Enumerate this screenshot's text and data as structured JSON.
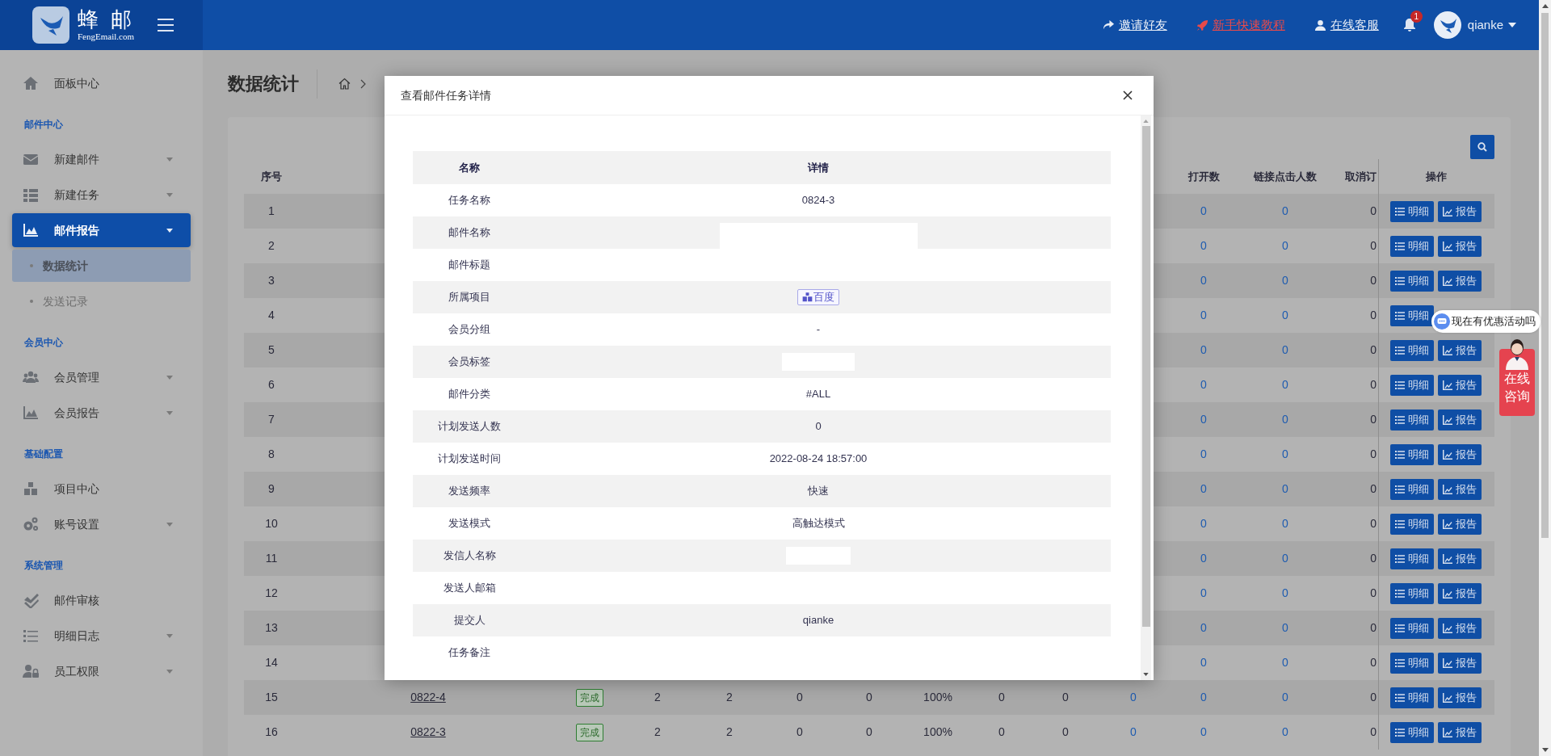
{
  "header": {
    "logo_text": "蜂 邮",
    "logo_subtext": "FengEmail.com",
    "links": [
      {
        "label": "邀请好友",
        "kind": "normal"
      },
      {
        "label": "新手快速教程",
        "kind": "highlight"
      },
      {
        "label": "在线客服",
        "kind": "normal"
      }
    ],
    "notifications": "1",
    "user": "qianke"
  },
  "sidebar": [
    {
      "kind": "item",
      "label": "面板中心",
      "expandable": false,
      "selected": false
    },
    {
      "kind": "section",
      "label": "邮件中心"
    },
    {
      "kind": "item",
      "label": "新建邮件",
      "expandable": true,
      "selected": false
    },
    {
      "kind": "item",
      "label": "新建任务",
      "expandable": true,
      "selected": false
    },
    {
      "kind": "item",
      "label": "邮件报告",
      "expandable": true,
      "selected": true,
      "children": [
        {
          "label": "数据统计",
          "selected": true
        },
        {
          "label": "发送记录",
          "selected": false
        }
      ]
    },
    {
      "kind": "section",
      "label": "会员中心"
    },
    {
      "kind": "item",
      "label": "会员管理",
      "expandable": true,
      "selected": false
    },
    {
      "kind": "item",
      "label": "会员报告",
      "expandable": true,
      "selected": false
    },
    {
      "kind": "section",
      "label": "基础配置"
    },
    {
      "kind": "item",
      "label": "项目中心",
      "expandable": false,
      "selected": false
    },
    {
      "kind": "item",
      "label": "账号设置",
      "expandable": true,
      "selected": false
    },
    {
      "kind": "section",
      "label": "系统管理"
    },
    {
      "kind": "item",
      "label": "邮件审核",
      "expandable": false,
      "selected": false
    },
    {
      "kind": "item",
      "label": "明细日志",
      "expandable": true,
      "selected": false
    },
    {
      "kind": "item",
      "label": "员工权限",
      "expandable": true,
      "selected": false
    }
  ],
  "page": {
    "title": "数据统计"
  },
  "table": {
    "columns": {
      "index": "序号",
      "opens": "打开数",
      "clicks": "链接点击人数",
      "unsubscribe": "取消订",
      "actions": "操作"
    },
    "rows": [
      {
        "index": "1",
        "opens": "0",
        "clicks": "0",
        "unsubscribe": "0",
        "actions": [
          "明细",
          "报告"
        ]
      },
      {
        "index": "2",
        "opens": "0",
        "clicks": "0",
        "unsubscribe": "0",
        "actions": [
          "明细",
          "报告"
        ]
      },
      {
        "index": "3",
        "opens": "0",
        "clicks": "0",
        "unsubscribe": "0",
        "actions": [
          "明细",
          "报告"
        ]
      },
      {
        "index": "4",
        "opens": "0",
        "clicks": "0",
        "unsubscribe": "0",
        "actions": [
          "明细"
        ]
      },
      {
        "index": "5",
        "opens": "0",
        "clicks": "0",
        "unsubscribe": "0",
        "actions": [
          "明细",
          "报告"
        ]
      },
      {
        "index": "6",
        "opens": "0",
        "clicks": "0",
        "unsubscribe": "0",
        "actions": [
          "明细",
          "报告"
        ]
      },
      {
        "index": "7",
        "opens": "0",
        "clicks": "0",
        "unsubscribe": "0",
        "actions": [
          "明细",
          "报告"
        ]
      },
      {
        "index": "8",
        "opens": "0",
        "clicks": "0",
        "unsubscribe": "0",
        "actions": [
          "明细",
          "报告"
        ]
      },
      {
        "index": "9",
        "opens": "0",
        "clicks": "0",
        "unsubscribe": "0",
        "actions": [
          "明细",
          "报告"
        ]
      },
      {
        "index": "10",
        "opens": "0",
        "clicks": "0",
        "unsubscribe": "0",
        "actions": [
          "明细",
          "报告"
        ]
      },
      {
        "index": "11",
        "opens": "0",
        "clicks": "0",
        "unsubscribe": "0",
        "actions": [
          "明细",
          "报告"
        ]
      },
      {
        "index": "12",
        "opens": "0",
        "clicks": "0",
        "unsubscribe": "0",
        "actions": [
          "明细",
          "报告"
        ]
      },
      {
        "index": "13",
        "opens": "0",
        "clicks": "0",
        "unsubscribe": "0",
        "actions": [
          "明细",
          "报告"
        ]
      },
      {
        "index": "14",
        "opens": "0",
        "clicks": "0",
        "unsubscribe": "0",
        "actions": [
          "明细",
          "报告"
        ]
      },
      {
        "index": "15",
        "name": "0822-4",
        "status": "完成",
        "cells": [
          {
            "text": "2",
            "link": false
          },
          {
            "text": "2",
            "link": false
          },
          {
            "text": "0",
            "link": false
          },
          {
            "text": "0",
            "link": false
          },
          {
            "text": "100%",
            "link": false
          },
          {
            "text": "0",
            "link": false
          },
          {
            "text": "0",
            "link": false
          },
          {
            "text": "0",
            "link": true
          }
        ],
        "opens": "0",
        "clicks": "0",
        "unsubscribe": "0",
        "actions": [
          "明细",
          "报告"
        ]
      },
      {
        "index": "16",
        "name": "0822-3",
        "status": "完成",
        "cells": [
          {
            "text": "2",
            "link": false
          },
          {
            "text": "2",
            "link": false
          },
          {
            "text": "0",
            "link": false
          },
          {
            "text": "0",
            "link": false
          },
          {
            "text": "100%",
            "link": false
          },
          {
            "text": "0",
            "link": false
          },
          {
            "text": "0",
            "link": false
          },
          {
            "text": "0",
            "link": true
          }
        ],
        "opens": "0",
        "clicks": "0",
        "unsubscribe": "0",
        "actions": [
          "明细",
          "报告"
        ]
      }
    ]
  },
  "modal": {
    "title": "查看邮件任务详情",
    "columns": [
      "名称",
      "详情"
    ],
    "rows": [
      {
        "label": "任务名称",
        "kind": "text",
        "value": "0824-3"
      },
      {
        "label": "邮件名称",
        "kind": "redacted"
      },
      {
        "label": "邮件标题",
        "kind": "empty"
      },
      {
        "label": "所属项目",
        "kind": "tag",
        "value": "百度"
      },
      {
        "label": "会员分组",
        "kind": "text",
        "value": "-"
      },
      {
        "label": "会员标签",
        "kind": "redacted"
      },
      {
        "label": "邮件分类",
        "kind": "text",
        "value": "#ALL"
      },
      {
        "label": "计划发送人数",
        "kind": "text",
        "value": "0"
      },
      {
        "label": "计划发送时间",
        "kind": "text",
        "value": "2022-08-24 18:57:00"
      },
      {
        "label": "发送频率",
        "kind": "text",
        "value": "快速"
      },
      {
        "label": "发送模式",
        "kind": "text",
        "value": "高触达模式"
      },
      {
        "label": "发信人名称",
        "kind": "redacted"
      },
      {
        "label": "发送人邮箱",
        "kind": "empty"
      },
      {
        "label": "提交人",
        "kind": "text",
        "value": "qianke"
      },
      {
        "label": "任务备注",
        "kind": "empty"
      }
    ]
  },
  "chat_widget": {
    "bubble": "现在有优惠活动吗",
    "button_lines": [
      "在线",
      "咨询"
    ]
  }
}
